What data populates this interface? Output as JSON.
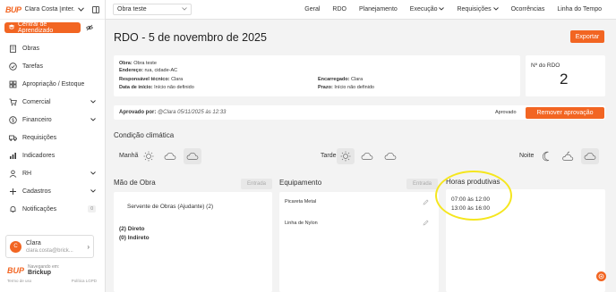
{
  "sidebar": {
    "logo_text": "BUP",
    "user_top": "Clara Costa [inter...",
    "cap_button": "Central de Aprendizado",
    "items": [
      {
        "label": "Obras",
        "icon": "building-icon"
      },
      {
        "label": "Tarefas",
        "icon": "check-circle-icon"
      },
      {
        "label": "Apropriação / Estoque",
        "icon": "grid-icon"
      },
      {
        "label": "Comercial",
        "icon": "cart-icon",
        "expand": true
      },
      {
        "label": "Financeiro",
        "icon": "dollar-icon",
        "expand": true
      },
      {
        "label": "Requisições",
        "icon": "truck-icon"
      },
      {
        "label": "Indicadores",
        "icon": "chart-icon"
      },
      {
        "label": "RH",
        "icon": "person-icon",
        "expand": true
      },
      {
        "label": "Cadastros",
        "icon": "plus-icon",
        "expand": true
      },
      {
        "label": "Notificações",
        "icon": "bell-icon",
        "badge": "0"
      }
    ],
    "user_card": {
      "initial": "C",
      "name": "Clara",
      "email": "clara.costa@brick..."
    },
    "footer": {
      "logo": "BUP",
      "sub": "Navegando em:",
      "brand": "Brickup",
      "terms": "Termo de uso",
      "privacy": "Política LGPD"
    }
  },
  "topbar": {
    "obra_select": "Obra teste",
    "nav": [
      "Geral",
      "RDO",
      "Planejamento",
      "Execução",
      "Requisições",
      "Ocorrências",
      "Linha do Tempo"
    ],
    "nav_dropdowns": [
      false,
      false,
      false,
      true,
      true,
      false,
      false
    ]
  },
  "main": {
    "title": "RDO - 5 de novembro de 2025",
    "export_button": "Exportar",
    "info": {
      "obra_label": "Obra:",
      "obra_value": "Obra teste",
      "endereco_label": "Endereço:",
      "endereco_value": "rua, cidade-AC",
      "resp_label": "Responsável técnico:",
      "resp_value": "Clara",
      "inicio_label": "Data de início:",
      "inicio_value": "Início não definido",
      "encarregado_label": "Encarregado:",
      "encarregado_value": "Clara",
      "prazo_label": "Prazo:",
      "prazo_value": "Início não definido"
    },
    "rdo_number_label": "Nº do RDO",
    "rdo_number": "2",
    "approval": {
      "by_label": "Aprovado por:",
      "by_value": "@Clara 05/11/2025 às 12:33",
      "status": "Aprovado",
      "remove_button": "Remover aprovação"
    },
    "weather": {
      "title": "Condição climática",
      "periods": [
        {
          "label": "Manhã",
          "selected": "cloud"
        },
        {
          "label": "Tarde",
          "selected": "sun"
        },
        {
          "label": "Noite",
          "selected": "cloud"
        }
      ]
    },
    "mao_de_obra": {
      "title": "Mão de Obra",
      "entrada": "Entrada",
      "item": "Servente de Obras (Ajudante) (2)",
      "direto": "(2) Direto",
      "indireto": "(0) Indireto"
    },
    "equipamento": {
      "title": "Equipamento",
      "entrada": "Entrada",
      "items": [
        "Picareta Metal",
        "Linha de Nylon"
      ]
    },
    "horas": {
      "title": "Horas produtivas",
      "lines": [
        "07:00 às 12:00",
        "13:00 às 16:00"
      ]
    },
    "accent_color": "#f26522",
    "highlight_color": "#f5e61e"
  }
}
